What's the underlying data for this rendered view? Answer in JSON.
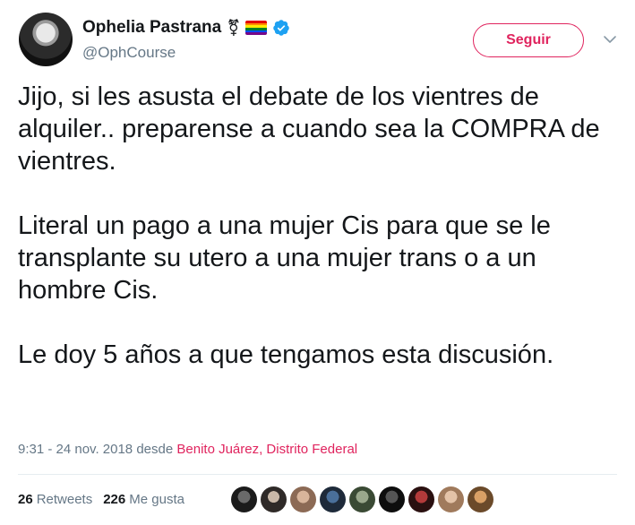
{
  "author": {
    "name": "Ophelia Pastrana",
    "handle": "@OphCourse",
    "trans_symbol": "⚧"
  },
  "follow_button": {
    "label": "Seguir"
  },
  "tweet": {
    "paragraphs": [
      "Jijo, si les asusta el debate de los vientres de alquiler.. preparense a cuando sea la COMPRA de vientres.",
      "Literal un pago a una mujer Cis para que se le transplante su utero a una mujer trans o a un hombre Cis.",
      "Le doy 5 años a que tengamos esta discusión."
    ]
  },
  "meta": {
    "time": "9:31 - 24 nov. 2018",
    "from_label": "desde",
    "place": "Benito Juárez, Distrito Federal"
  },
  "stats": {
    "retweets_count": "26",
    "retweets_label": "Retweets",
    "likes_count": "226",
    "likes_label": "Me gusta"
  },
  "colors": {
    "accent": "#e0245e",
    "verified": "#1da1f2",
    "secondary_text": "#657786"
  },
  "icons": {
    "verified": "verified-badge-icon",
    "rainbow_flag": "rainbow-flag-icon",
    "chevron": "chevron-down-icon"
  }
}
